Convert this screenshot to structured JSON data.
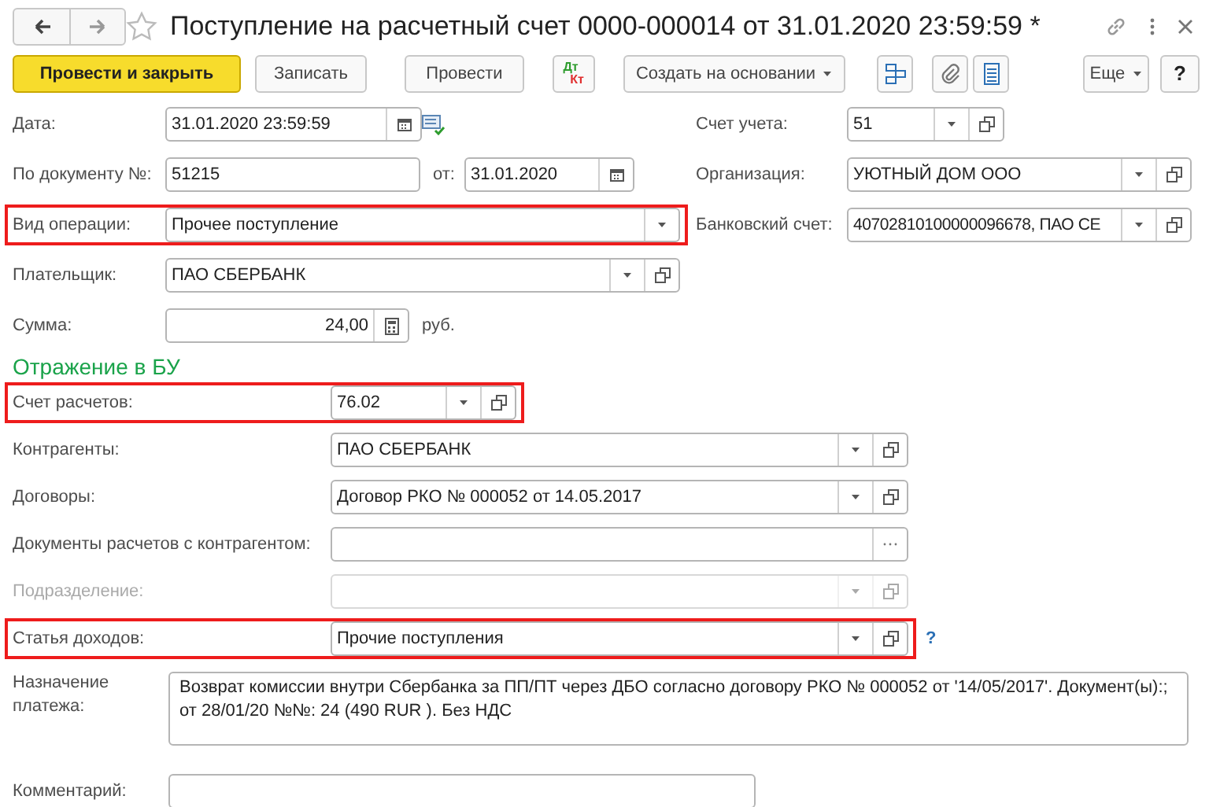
{
  "window": {
    "title": "Поступление на расчетный счет 0000-000014 от 31.01.2020 23:59:59 *"
  },
  "toolbar": [
    {
      "label": "Провести и закрыть",
      "kind": "primary"
    },
    {
      "label": "Записать",
      "kind": "default"
    },
    {
      "label": "Провести",
      "kind": "default"
    },
    {
      "label": "Дт",
      "label_bottom": "Кт",
      "kind": "dtkt"
    },
    {
      "label": "Создать на основании",
      "kind": "menu"
    },
    {
      "kind": "structure"
    },
    {
      "kind": "attach"
    },
    {
      "kind": "list"
    },
    {
      "label": "Еще",
      "kind": "menu"
    },
    {
      "label": "?",
      "kind": "default"
    }
  ],
  "header": {
    "date": {
      "label": "Дата:",
      "value": "31.01.2020 23:59:59"
    },
    "doc_number": {
      "label": "По документу №:",
      "value": "51215"
    },
    "doc_date": {
      "label": "от:",
      "value": "31.01.2020"
    },
    "operation": {
      "label": "Вид операции:",
      "value": "Прочее поступление",
      "highlighted": true
    },
    "payer": {
      "label": "Плательщик:",
      "value": "ПАО СБЕРБАНК",
      "highlighted": false
    },
    "amount": {
      "label": "Сумма:",
      "value": "24,00",
      "unit": "руб."
    },
    "account": {
      "label": "Счет учета:",
      "value": "51"
    },
    "organization": {
      "label": "Организация:",
      "value": "УЮТНЫЙ ДОМ ООО"
    },
    "bank_account": {
      "label": "Банковский счет:",
      "value": "40702810100000096678, ПАО СЕ"
    }
  },
  "accounting": {
    "title": "Отражение в БУ",
    "fields": [
      {
        "label": "Счет расчетов:",
        "value": "76.02",
        "kind": "short",
        "highlighted": true,
        "disabled": false
      },
      {
        "label": "Контрагенты:",
        "value": "ПАО СБЕРБАНК",
        "kind": "select",
        "highlighted": false,
        "disabled": false
      },
      {
        "label": "Договоры:",
        "value": "Договор РКО № 000052 от 14.05.2017",
        "kind": "select",
        "highlighted": false,
        "disabled": false
      },
      {
        "label": "Документы расчетов с контрагентом:",
        "kind": "choice",
        "highlighted": false,
        "disabled": false
      },
      {
        "label": "Подразделение:",
        "kind": "select",
        "highlighted": false,
        "disabled": true
      },
      {
        "label": "Статья доходов:",
        "value": "Прочие поступления",
        "kind": "select",
        "highlighted": true,
        "disabled": false,
        "help": "?"
      }
    ]
  },
  "purpose": {
    "label": "Назначение платежа:",
    "value": "Возврат комиссии внутри Сбербанка за ПП/ПТ через ДБО согласно договору РКО № 000052 от '14/05/2017'. Документ(ы):; от 28/01/20 №№: 24 (490 RUR  ). Без НДС"
  },
  "comment": {
    "label": "Комментарий:"
  }
}
